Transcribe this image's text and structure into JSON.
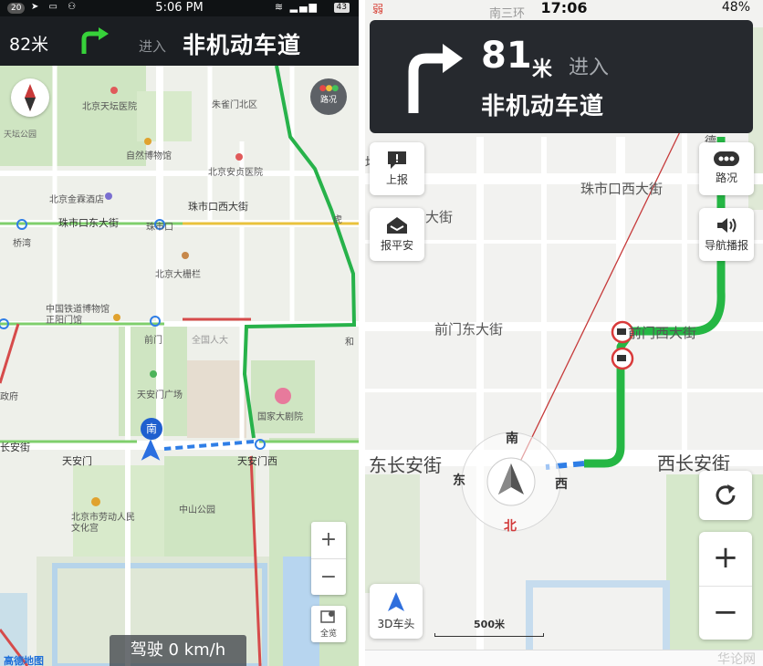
{
  "left": {
    "status": {
      "badge": "20",
      "time": "5:06 PM",
      "battery": "43"
    },
    "guidance": {
      "distance": "82米",
      "enter": "进入",
      "road": "非机动车道"
    },
    "labels": {
      "tiantan": "天坛公园",
      "tianhe": "北京天坛医院",
      "zhuque": "朱雀门北区",
      "ziran": "自然博物馆",
      "anzhen": "北京安贞医院",
      "jingu": "北京金霖酒店",
      "zhushikou_x": "珠市口西大街",
      "zhushikou": "珠市口",
      "zhushikou_e": "珠市口东大街",
      "huqiao": "虎",
      "qiaowan": "桥湾",
      "dashilan": "北京大栅栏",
      "railway": "中国铁道博物馆正阳门馆",
      "qianmen": "前门",
      "renda": "全国人大",
      "tam_sq": "天安门广场",
      "theatre": "国家大剧院",
      "zhengfu": "政府",
      "changan": "长安街",
      "tam_w1": "天安门",
      "tam_w2": "天安门西",
      "zhongshan": "中山公园",
      "laodong": "北京市劳动人民文化宫",
      "he": "和"
    },
    "traffic_label": "路况",
    "car_label": "南",
    "overview_label": "全览",
    "speed": "驾驶 0 km/h",
    "logo": "高德地图"
  },
  "right": {
    "status": {
      "carrier": "弱",
      "time": "17:06",
      "battery": "48%"
    },
    "guidance": {
      "distance": "81",
      "unit": "米",
      "enter": "进入",
      "road": "非机动车道"
    },
    "buttons": {
      "report": "上报",
      "safe": "报平安",
      "traffic": "路况",
      "voice": "导航播报",
      "mode3d": "3D车头"
    },
    "labels": {
      "nansanhuan": "南三环",
      "tan": "坛",
      "dajie": "大街",
      "zhushikou_xi": "珠市口西大街",
      "qianmen_dong": "前门东大街",
      "qianmen_xi": "前门西大街",
      "dongchangan": "东长安街",
      "xichangan": "西长安街",
      "tan2": "德"
    },
    "compass": {
      "n": "北",
      "s": "南",
      "e": "东",
      "w": "西"
    },
    "scale": "500米",
    "watermark": "华论网"
  }
}
